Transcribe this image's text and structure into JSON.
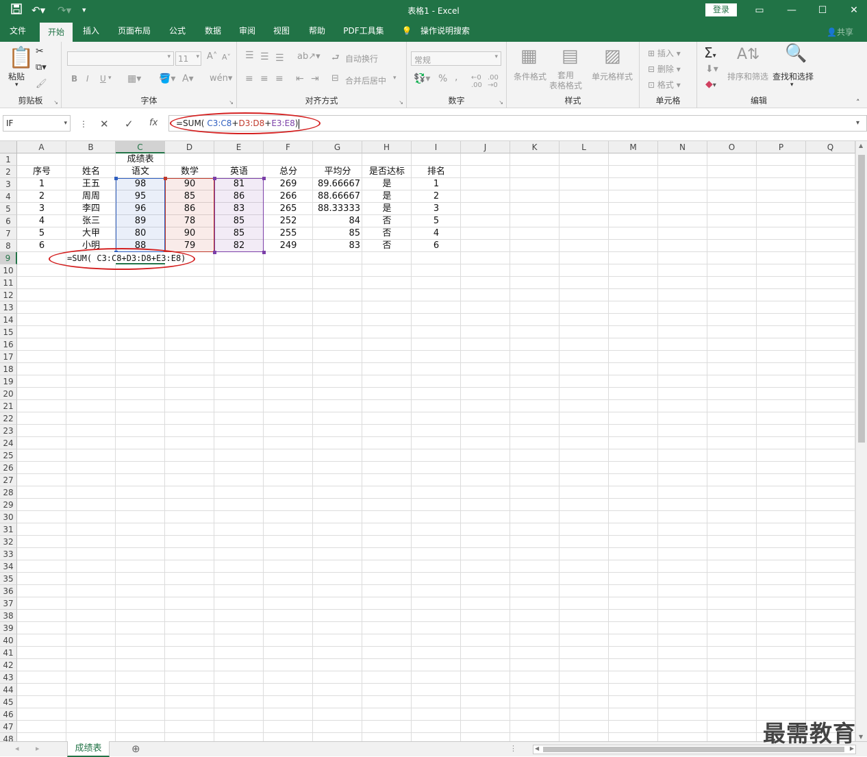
{
  "titlebar": {
    "title": "表格1  -  Excel",
    "login": "登录",
    "save_icon": "save-icon",
    "undo_icon": "undo-icon",
    "redo_icon": "redo-icon"
  },
  "tabs": [
    "文件",
    "开始",
    "插入",
    "页面布局",
    "公式",
    "数据",
    "审阅",
    "视图",
    "帮助",
    "PDF工具集",
    "操作说明搜索"
  ],
  "active_tab": "开始",
  "share": "共享",
  "ribbon": {
    "clipboard": {
      "label": "剪贴板",
      "paste": "粘贴"
    },
    "font": {
      "label": "字体",
      "size": "11",
      "bold": "B",
      "italic": "I",
      "underline": "U"
    },
    "alignment": {
      "label": "对齐方式",
      "wrap": "自动换行",
      "merge": "合并后居中"
    },
    "number": {
      "label": "数字",
      "format": "常规",
      "percent": "%",
      "comma": ","
    },
    "styles": {
      "label": "样式",
      "conditional": "条件格式",
      "table": "套用\n表格格式",
      "cell_styles": "单元格样式"
    },
    "cells": {
      "label": "单元格",
      "insert": "插入",
      "delete": "删除",
      "format": "格式"
    },
    "editing": {
      "label": "编辑",
      "sort": "排序和筛选",
      "find": "查找和选择"
    }
  },
  "formula_bar": {
    "name_box": "IF",
    "formula_parts": [
      {
        "text": "=SUM( ",
        "color": "#222222"
      },
      {
        "text": "C3:C8",
        "color": "#2f5fc0"
      },
      {
        "text": "+",
        "color": "#222222"
      },
      {
        "text": "D3:D8",
        "color": "#c0392b"
      },
      {
        "text": "+",
        "color": "#222222"
      },
      {
        "text": "E3:E8",
        "color": "#7b3fa8"
      },
      {
        "text": ")",
        "color": "#222222"
      }
    ]
  },
  "columns": [
    "A",
    "B",
    "C",
    "D",
    "E",
    "F",
    "G",
    "H",
    "I",
    "J",
    "K",
    "L",
    "M",
    "N",
    "O",
    "P",
    "Q"
  ],
  "selected_column": "C",
  "selected_row": "9",
  "rows": [
    "1",
    "2",
    "3",
    "4",
    "5",
    "6",
    "7",
    "8",
    "9",
    "10",
    "11",
    "12",
    "13",
    "14",
    "15",
    "16",
    "17",
    "18",
    "19",
    "20",
    "21",
    "22",
    "23",
    "24",
    "25",
    "26",
    "27",
    "28",
    "29",
    "30",
    "31",
    "32",
    "33",
    "34",
    "35",
    "36",
    "37",
    "38",
    "39",
    "40",
    "41",
    "42",
    "43",
    "44",
    "45",
    "46",
    "47",
    "48"
  ],
  "sheet": {
    "title": "成绩表",
    "headers": [
      "序号",
      "姓名",
      "语文",
      "数学",
      "英语",
      "总分",
      "平均分",
      "是否达标",
      "排名"
    ],
    "data": [
      [
        "1",
        "王五",
        "98",
        "90",
        "81",
        "269",
        "89.66667",
        "是",
        "1"
      ],
      [
        "2",
        "周周",
        "95",
        "85",
        "86",
        "266",
        "88.66667",
        "是",
        "2"
      ],
      [
        "3",
        "李四",
        "96",
        "86",
        "83",
        "265",
        "88.33333",
        "是",
        "3"
      ],
      [
        "4",
        "张三",
        "89",
        "78",
        "85",
        "252",
        "84",
        "否",
        "5"
      ],
      [
        "5",
        "大甲",
        "80",
        "90",
        "85",
        "255",
        "85",
        "否",
        "4"
      ],
      [
        "6",
        "小明",
        "88",
        "79",
        "82",
        "249",
        "83",
        "否",
        "6"
      ]
    ],
    "editing_cell_formula": "=SUM( C3:C8+D3:D8+E3:E8)"
  },
  "range_colors": {
    "C": "#2f5fc0",
    "D": "#c0392b",
    "E": "#7b3fa8"
  },
  "sheet_tab": "成绩表",
  "watermark": "最需教育"
}
